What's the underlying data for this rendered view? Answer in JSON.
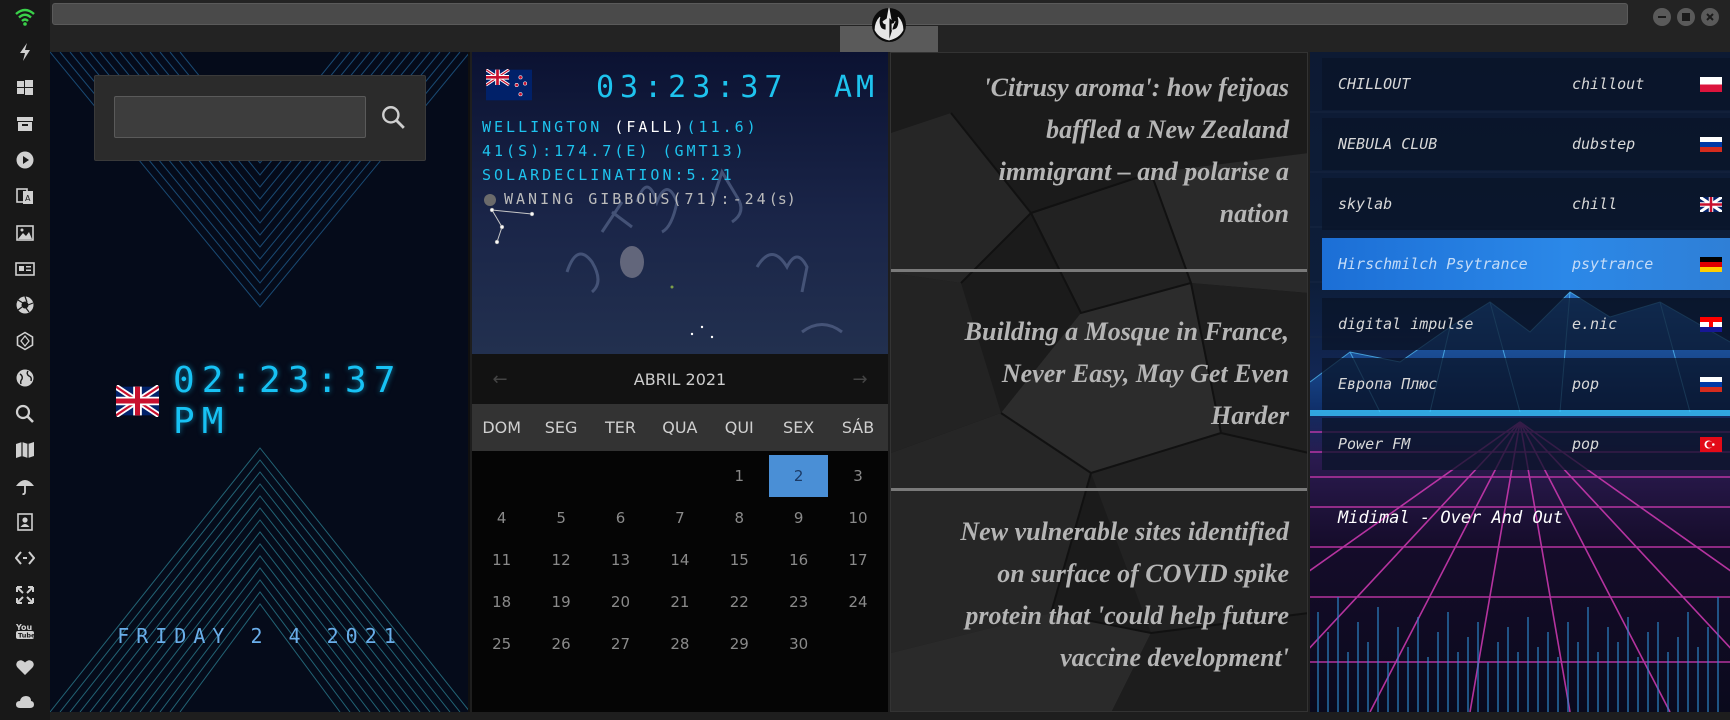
{
  "sidebar": {
    "icons": [
      "wifi-icon",
      "lightning-icon",
      "windows-icon",
      "archive-icon",
      "play-icon",
      "translate-icon",
      "image-icon",
      "news-icon",
      "aperture-icon",
      "hexagon-icon",
      "globe-icon",
      "search-icon",
      "map-icon",
      "umbrella-icon",
      "contacts-icon",
      "code-icon",
      "expand-icon",
      "youtube-icon",
      "heart-icon",
      "cloud-icon"
    ]
  },
  "window": {
    "logo": "rebel-alliance-icon"
  },
  "search": {
    "value": "",
    "placeholder": ""
  },
  "local_clock": {
    "time": "02:23:37 PM",
    "date": "FRIDAY 2 4 2021"
  },
  "world_clock": {
    "time": "03:23:37",
    "ampm": "AM",
    "city": "WELLINGTON",
    "season": "(FALL)",
    "temp": "(11.6)",
    "coords": "41(S):174.7(E) (GMT13)",
    "declination": "SOLARDECLINATION:5.21",
    "moon": "WANING GIBBOUS(71):-24",
    "moon_unit": "(s)"
  },
  "calendar": {
    "month_label": "ABRIL 2021",
    "prev": "←",
    "next": "→",
    "weekdays": [
      "DOM",
      "SEG",
      "TER",
      "QUA",
      "QUI",
      "SEX",
      "SÁB"
    ],
    "weeks": [
      [
        "",
        "",
        "",
        "",
        "1",
        "2",
        "3"
      ],
      [
        "4",
        "5",
        "6",
        "7",
        "8",
        "9",
        "10"
      ],
      [
        "11",
        "12",
        "13",
        "14",
        "15",
        "16",
        "17"
      ],
      [
        "18",
        "19",
        "20",
        "21",
        "22",
        "23",
        "24"
      ],
      [
        "25",
        "26",
        "27",
        "28",
        "29",
        "30",
        ""
      ]
    ],
    "today": "2"
  },
  "news": [
    {
      "lines": [
        "'Citrusy aroma': how feijoas",
        "baffled a New Zealand",
        "immigrant – and polarise a",
        "nation"
      ]
    },
    {
      "lines": [
        "Building a Mosque in France,",
        "Never Easy, May Get Even",
        "Harder"
      ]
    },
    {
      "lines": [
        "New vulnerable sites identified",
        "on surface of COVID spike",
        "protein that 'could help future",
        "vaccine development'"
      ]
    }
  ],
  "radio": {
    "stations": [
      {
        "name": "CHILLOUT",
        "genre": "chillout",
        "flag": "poland-flag",
        "active": false
      },
      {
        "name": "NEBULA CLUB",
        "genre": "dubstep",
        "flag": "russia-flag",
        "active": false
      },
      {
        "name": "skylab",
        "genre": "chill",
        "flag": "uk-flag",
        "active": false
      },
      {
        "name": "Hirschmilch Psytrance",
        "genre": "psytrance",
        "flag": "germany-flag",
        "active": true
      },
      {
        "name": "digital impulse",
        "genre": "e.nic",
        "flag": "croatia-flag",
        "active": false
      },
      {
        "name": "Европа Плюс",
        "genre": "pop",
        "flag": "russia-flag",
        "active": false
      },
      {
        "name": "Power FM",
        "genre": "pop",
        "flag": "turkey-flag",
        "active": false
      }
    ],
    "now_playing": "Midimal - Over And Out"
  },
  "colors": {
    "clock": "#17c2f4",
    "today": "#4a8fd6",
    "accent_cyan": "#1ec3ee"
  }
}
